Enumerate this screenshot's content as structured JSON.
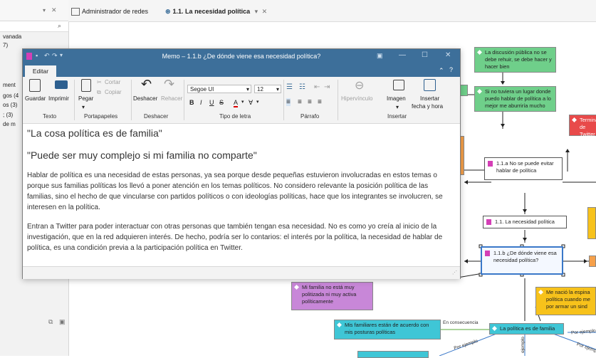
{
  "left_panel": {
    "fragments": [
      "vanada",
      "7)",
      "ment",
      "gos (4",
      "os (3)",
      "; (3)",
      "de m"
    ]
  },
  "tabs": [
    {
      "label": "Administrador de redes"
    },
    {
      "label": "1.1. La necesidad política"
    }
  ],
  "memo": {
    "title": "Memo – 1.1.b ¿De dónde viene esa necesidad política?",
    "ribbon_tab": "Editar",
    "ribbon": {
      "guardar": "Guardar",
      "imprimir": "Imprimir",
      "pegar": "Pegar",
      "cortar": "Cortar",
      "copiar": "Copiar",
      "deshacer": "Deshacer",
      "rehacer": "Rehacer",
      "font": "Segoe UI",
      "size": "12",
      "hipervinculo": "Hipervínculo",
      "imagen": "Imagen",
      "insertar_fecha": "Insertar",
      "insertar_fecha2": "fecha y hora",
      "groups": {
        "texto": "Texto",
        "portapapeles": "Portapapeles",
        "deshacer": "Deshacer",
        "tipo_letra": "Tipo de letra",
        "parrafo": "Párrafo",
        "insertar": "Insertar"
      }
    },
    "heading1": "\"La cosa política es de familia\"",
    "heading2": "\"Puede ser muy complejo si mi familia no comparte\"",
    "paragraph1": "Hablar de política es una necesidad de estas personas, ya sea porque desde pequeñas estuvieron involucradas en estos temas o porque sus familias políticas los llevó a poner atención en los temas políticos. No considero relevante la posición política de las familias, sino el hecho de que vincularse con partidos políticos o con ideologías políticas, hace que los integrantes se involucren, se interesen en la política.",
    "paragraph2": "Entran a Twitter para poder interactuar con otras personas que también tengan esa necesidad. No es como yo creía al inicio de la investigación, que en la red adquieren interés.  De hecho, podría ser lo contarios: el interés por la política, la necesidad de hablar de política, es una condición previa a la participación política en Twitter."
  },
  "network": {
    "nodes": {
      "discusion": "La discusión pública no se debe rehuir, se debe hacer y hacer bien",
      "sino_tuviera": "Si no tuviera un lugar donde puedo hablar de política a lo mejor me aburriría mucho",
      "terminando": "Terminando de Twitter",
      "no_puede": "1.1.a No se puede evitar hablar de política",
      "necesidad": "1.1. La necesidad política",
      "donde_viene": "1.1.b ¿De dónde viene esa necesidad política?",
      "familia_no": "Mi familia no está muy politizada ni muy activa políticamente",
      "me_nacio": "Me nació la espina política cuando me por armar un sind",
      "familiares": "Mis familiares están de acuerdo con mis posturas políticas",
      "es_de_familia": "La política es de familia"
    },
    "edge_labels": {
      "asociado": "sociad",
      "en_consecuencia": "En consecuencia",
      "por_ejemplo1": "Por ejemplo",
      "por_ejemplo2": "Por ejemplo",
      "por_ejemplo3": "Por ejemplo",
      "ejemplo4": "ejemplo",
      "es": "es"
    }
  },
  "colors": {
    "green_node": "#6fcf8a",
    "red_node": "#e84a4a",
    "purple_node": "#c887d8",
    "cyan_node": "#3fc6d6",
    "yellow_node": "#f7c21b",
    "orange_node": "#f6a04a",
    "title_bar": "#3d6f9a"
  }
}
